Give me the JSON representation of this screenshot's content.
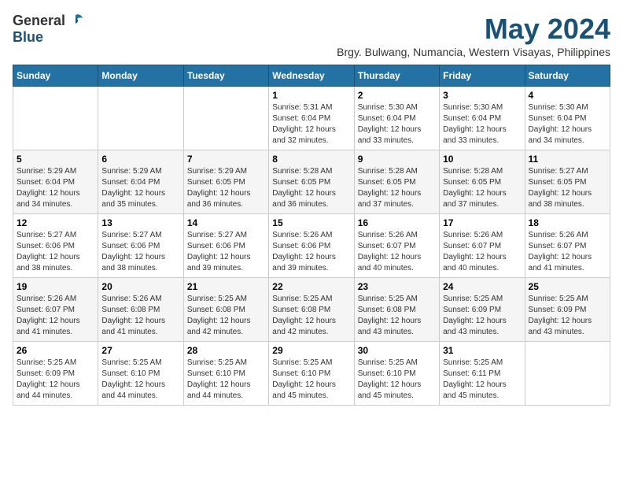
{
  "header": {
    "logo": {
      "general": "General",
      "blue": "Blue"
    },
    "title": "May 2024",
    "location": "Brgy. Bulwang, Numancia, Western Visayas, Philippines"
  },
  "weekdays": [
    "Sunday",
    "Monday",
    "Tuesday",
    "Wednesday",
    "Thursday",
    "Friday",
    "Saturday"
  ],
  "weeks": [
    [
      {
        "day": "",
        "sunrise": "",
        "sunset": "",
        "daylight": ""
      },
      {
        "day": "",
        "sunrise": "",
        "sunset": "",
        "daylight": ""
      },
      {
        "day": "",
        "sunrise": "",
        "sunset": "",
        "daylight": ""
      },
      {
        "day": "1",
        "sunrise": "Sunrise: 5:31 AM",
        "sunset": "Sunset: 6:04 PM",
        "daylight": "Daylight: 12 hours and 32 minutes."
      },
      {
        "day": "2",
        "sunrise": "Sunrise: 5:30 AM",
        "sunset": "Sunset: 6:04 PM",
        "daylight": "Daylight: 12 hours and 33 minutes."
      },
      {
        "day": "3",
        "sunrise": "Sunrise: 5:30 AM",
        "sunset": "Sunset: 6:04 PM",
        "daylight": "Daylight: 12 hours and 33 minutes."
      },
      {
        "day": "4",
        "sunrise": "Sunrise: 5:30 AM",
        "sunset": "Sunset: 6:04 PM",
        "daylight": "Daylight: 12 hours and 34 minutes."
      }
    ],
    [
      {
        "day": "5",
        "sunrise": "Sunrise: 5:29 AM",
        "sunset": "Sunset: 6:04 PM",
        "daylight": "Daylight: 12 hours and 34 minutes."
      },
      {
        "day": "6",
        "sunrise": "Sunrise: 5:29 AM",
        "sunset": "Sunset: 6:04 PM",
        "daylight": "Daylight: 12 hours and 35 minutes."
      },
      {
        "day": "7",
        "sunrise": "Sunrise: 5:29 AM",
        "sunset": "Sunset: 6:05 PM",
        "daylight": "Daylight: 12 hours and 36 minutes."
      },
      {
        "day": "8",
        "sunrise": "Sunrise: 5:28 AM",
        "sunset": "Sunset: 6:05 PM",
        "daylight": "Daylight: 12 hours and 36 minutes."
      },
      {
        "day": "9",
        "sunrise": "Sunrise: 5:28 AM",
        "sunset": "Sunset: 6:05 PM",
        "daylight": "Daylight: 12 hours and 37 minutes."
      },
      {
        "day": "10",
        "sunrise": "Sunrise: 5:28 AM",
        "sunset": "Sunset: 6:05 PM",
        "daylight": "Daylight: 12 hours and 37 minutes."
      },
      {
        "day": "11",
        "sunrise": "Sunrise: 5:27 AM",
        "sunset": "Sunset: 6:05 PM",
        "daylight": "Daylight: 12 hours and 38 minutes."
      }
    ],
    [
      {
        "day": "12",
        "sunrise": "Sunrise: 5:27 AM",
        "sunset": "Sunset: 6:06 PM",
        "daylight": "Daylight: 12 hours and 38 minutes."
      },
      {
        "day": "13",
        "sunrise": "Sunrise: 5:27 AM",
        "sunset": "Sunset: 6:06 PM",
        "daylight": "Daylight: 12 hours and 38 minutes."
      },
      {
        "day": "14",
        "sunrise": "Sunrise: 5:27 AM",
        "sunset": "Sunset: 6:06 PM",
        "daylight": "Daylight: 12 hours and 39 minutes."
      },
      {
        "day": "15",
        "sunrise": "Sunrise: 5:26 AM",
        "sunset": "Sunset: 6:06 PM",
        "daylight": "Daylight: 12 hours and 39 minutes."
      },
      {
        "day": "16",
        "sunrise": "Sunrise: 5:26 AM",
        "sunset": "Sunset: 6:07 PM",
        "daylight": "Daylight: 12 hours and 40 minutes."
      },
      {
        "day": "17",
        "sunrise": "Sunrise: 5:26 AM",
        "sunset": "Sunset: 6:07 PM",
        "daylight": "Daylight: 12 hours and 40 minutes."
      },
      {
        "day": "18",
        "sunrise": "Sunrise: 5:26 AM",
        "sunset": "Sunset: 6:07 PM",
        "daylight": "Daylight: 12 hours and 41 minutes."
      }
    ],
    [
      {
        "day": "19",
        "sunrise": "Sunrise: 5:26 AM",
        "sunset": "Sunset: 6:07 PM",
        "daylight": "Daylight: 12 hours and 41 minutes."
      },
      {
        "day": "20",
        "sunrise": "Sunrise: 5:26 AM",
        "sunset": "Sunset: 6:08 PM",
        "daylight": "Daylight: 12 hours and 41 minutes."
      },
      {
        "day": "21",
        "sunrise": "Sunrise: 5:25 AM",
        "sunset": "Sunset: 6:08 PM",
        "daylight": "Daylight: 12 hours and 42 minutes."
      },
      {
        "day": "22",
        "sunrise": "Sunrise: 5:25 AM",
        "sunset": "Sunset: 6:08 PM",
        "daylight": "Daylight: 12 hours and 42 minutes."
      },
      {
        "day": "23",
        "sunrise": "Sunrise: 5:25 AM",
        "sunset": "Sunset: 6:08 PM",
        "daylight": "Daylight: 12 hours and 43 minutes."
      },
      {
        "day": "24",
        "sunrise": "Sunrise: 5:25 AM",
        "sunset": "Sunset: 6:09 PM",
        "daylight": "Daylight: 12 hours and 43 minutes."
      },
      {
        "day": "25",
        "sunrise": "Sunrise: 5:25 AM",
        "sunset": "Sunset: 6:09 PM",
        "daylight": "Daylight: 12 hours and 43 minutes."
      }
    ],
    [
      {
        "day": "26",
        "sunrise": "Sunrise: 5:25 AM",
        "sunset": "Sunset: 6:09 PM",
        "daylight": "Daylight: 12 hours and 44 minutes."
      },
      {
        "day": "27",
        "sunrise": "Sunrise: 5:25 AM",
        "sunset": "Sunset: 6:10 PM",
        "daylight": "Daylight: 12 hours and 44 minutes."
      },
      {
        "day": "28",
        "sunrise": "Sunrise: 5:25 AM",
        "sunset": "Sunset: 6:10 PM",
        "daylight": "Daylight: 12 hours and 44 minutes."
      },
      {
        "day": "29",
        "sunrise": "Sunrise: 5:25 AM",
        "sunset": "Sunset: 6:10 PM",
        "daylight": "Daylight: 12 hours and 45 minutes."
      },
      {
        "day": "30",
        "sunrise": "Sunrise: 5:25 AM",
        "sunset": "Sunset: 6:10 PM",
        "daylight": "Daylight: 12 hours and 45 minutes."
      },
      {
        "day": "31",
        "sunrise": "Sunrise: 5:25 AM",
        "sunset": "Sunset: 6:11 PM",
        "daylight": "Daylight: 12 hours and 45 minutes."
      },
      {
        "day": "",
        "sunrise": "",
        "sunset": "",
        "daylight": ""
      }
    ]
  ]
}
